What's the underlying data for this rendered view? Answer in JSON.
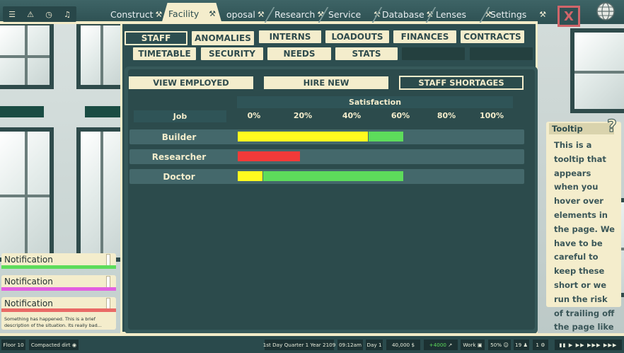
{
  "top_menu": {
    "quick_icons": [
      "menu-icon",
      "warning-icon",
      "clock-icon",
      "bell-icon"
    ],
    "tabs": [
      {
        "label": "Construct",
        "icon": "hammer-wrench-icon"
      },
      {
        "label": "Facility",
        "icon": "hammer-wrench-icon"
      },
      {
        "label": "oposal",
        "icon": "hammer-wrench-icon"
      },
      {
        "label": "Research",
        "icon": "hammer-wrench-icon"
      },
      {
        "label": "Service",
        "icon": "hammer-wrench-icon"
      },
      {
        "label": "Database",
        "icon": "hammer-wrench-icon"
      },
      {
        "label": "Lenses",
        "icon": "hammer-wrench-icon"
      },
      {
        "label": "Settings",
        "icon": "hammer-wrench-icon"
      }
    ],
    "active_tab": "Facility",
    "close_label": "X"
  },
  "facility": {
    "subtabs_row1": [
      "STAFF",
      "ANOMALIES",
      "INTERNS",
      "LOADOUTS",
      "FINANCES",
      "CONTRACTS"
    ],
    "subtabs_row2": [
      "TIMETABLE",
      "SECURITY",
      "NEEDS",
      "STATS"
    ],
    "active_subtab": "STAFF",
    "view_buttons": [
      "VIEW EMPLOYED",
      "HIRE NEW",
      "STAFF SHORTAGES"
    ],
    "active_view": "STAFF SHORTAGES",
    "table": {
      "job_header": "Job",
      "group_header": "Satisfaction",
      "ticks": [
        "0%",
        "20%",
        "40%",
        "60%",
        "80%",
        "100%"
      ],
      "rows": [
        {
          "job": "Builder",
          "segments": [
            {
              "fraction": 0.53,
              "color": "#fffb1f"
            },
            {
              "fraction": 0.14,
              "color": "#5ddc5b"
            }
          ]
        },
        {
          "job": "Researcher",
          "segments": [
            {
              "fraction": 0.255,
              "color": "#f23a39"
            }
          ]
        },
        {
          "job": "Doctor",
          "segments": [
            {
              "fraction": 0.1,
              "color": "#fffb1f"
            },
            {
              "fraction": 0.57,
              "color": "#5ddc5b"
            }
          ]
        }
      ]
    }
  },
  "tooltip": {
    "title": "Tooltip",
    "body": "This is a tooltip that appears when you hover over elements in the page. We have to be careful to keep these short or we run the risk of trailing off the page like this..."
  },
  "notifications": [
    {
      "title": "Notification",
      "color": "#5ddc5b"
    },
    {
      "title": "Notification",
      "color": "#e35fe0"
    },
    {
      "title": "Notification",
      "color": "#e96a66",
      "description": "Something has happened.  This is a brief description of the situation. Its really bad..."
    }
  ],
  "status_bar": {
    "floor": "Floor 10",
    "tile": "Compacted dirt",
    "date": "1st Day Quarter 1 Year 2109",
    "time": "09:12am",
    "day": "Day 1",
    "money": "40,000",
    "income": "+4000",
    "mode": "Work",
    "percent": "50%",
    "count_a": "19",
    "count_b": "1"
  },
  "colors": {
    "panel": "#2d4e50",
    "cream": "#f4edcc",
    "close_red": "#d0656a"
  }
}
